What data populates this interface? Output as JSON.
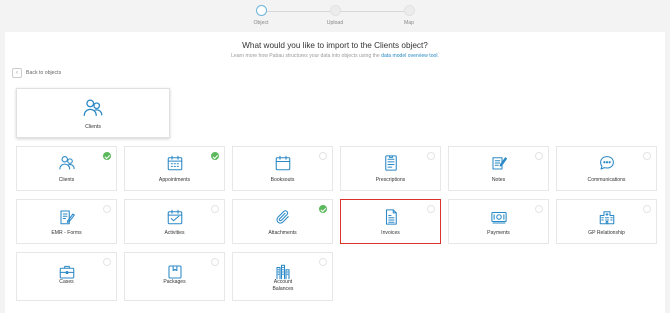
{
  "stepper": {
    "steps": [
      {
        "label": "Object",
        "active": true
      },
      {
        "label": "Upload",
        "active": false
      },
      {
        "label": "Map",
        "active": false
      }
    ]
  },
  "header": {
    "title": "What would you like to import to the Clients object?",
    "subtitle_prefix": "Learn more how Pabau structures your data into objects using the",
    "subtitle_link": "data model overview tool",
    "subtitle_suffix": "."
  },
  "back_label": "Back to objects",
  "selected_object": {
    "label": "Clients",
    "icon": "clients-icon"
  },
  "accent_color": "#2a88c6",
  "check_color": "#5cb85c",
  "highlight_color": "#d9332b",
  "objects": [
    {
      "label": "Clients",
      "icon": "clients-icon",
      "checked": true
    },
    {
      "label": "Appointments",
      "icon": "calendar-grid-icon",
      "checked": true
    },
    {
      "label": "Booksouts",
      "icon": "calendar-icon",
      "checked": false
    },
    {
      "label": "Prescriptions",
      "icon": "prescription-icon",
      "checked": false
    },
    {
      "label": "Notes",
      "icon": "notes-icon",
      "checked": false
    },
    {
      "label": "Communications",
      "icon": "chat-icon",
      "checked": false
    },
    {
      "label": "EMR - Forms",
      "icon": "form-edit-icon",
      "checked": false
    },
    {
      "label": "Activities",
      "icon": "activities-calendar-icon",
      "checked": false
    },
    {
      "label": "Attachments",
      "icon": "paperclip-icon",
      "checked": true
    },
    {
      "label": "Invoices",
      "icon": "invoice-icon",
      "checked": false,
      "highlighted": true
    },
    {
      "label": "Payments",
      "icon": "payment-icon",
      "checked": false
    },
    {
      "label": "GP Relationship",
      "icon": "hospital-icon",
      "checked": false
    },
    {
      "label": "Cases",
      "icon": "briefcase-icon",
      "checked": false
    },
    {
      "label": "Packages",
      "icon": "package-icon",
      "checked": false
    },
    {
      "label": "Account Balances",
      "icon": "account-balances-icon",
      "checked": false
    }
  ]
}
